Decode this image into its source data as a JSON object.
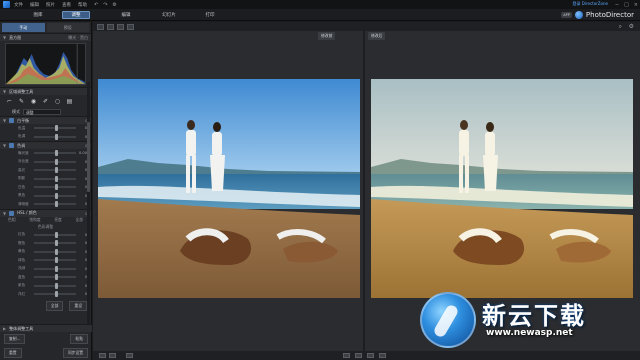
{
  "menubar": {
    "items": [
      "文件",
      "编辑",
      "照片",
      "查看",
      "帮助"
    ],
    "quick_icons": [
      "undo-icon",
      "redo-icon",
      "settings-icon"
    ],
    "signin": "登录 DirectorZone"
  },
  "window_controls": [
    "−",
    "□",
    "×"
  ],
  "modules": {
    "tabs": [
      {
        "label": "图库",
        "active": false
      },
      {
        "label": "调整",
        "active": true
      },
      {
        "label": "编辑",
        "active": false
      },
      {
        "label": "幻灯片",
        "active": false
      },
      {
        "label": "打印",
        "active": false
      }
    ]
  },
  "brand": {
    "badge": "APP",
    "title": "PhotoDirector"
  },
  "left_panel": {
    "tabs": [
      {
        "label": "手动",
        "active": true
      },
      {
        "label": "预设",
        "active": false
      }
    ],
    "histogram": {
      "title": "直方图",
      "right": "曝光 · 黑白"
    },
    "regional": {
      "title": "区域调整工具"
    },
    "mode": {
      "label": "模式",
      "value": "调整"
    },
    "white_balance": {
      "title": "白平衡",
      "sliders": [
        {
          "label": "色温",
          "value": "0",
          "pos": 0.5
        },
        {
          "label": "色调",
          "value": "0",
          "pos": 0.5
        }
      ]
    },
    "tone": {
      "title": "色调",
      "sliders": [
        {
          "label": "曝光度",
          "value": "0.00",
          "pos": 0.5
        },
        {
          "label": "对比度",
          "value": "0",
          "pos": 0.5
        },
        {
          "label": "高光",
          "value": "0",
          "pos": 0.5
        },
        {
          "label": "阴影",
          "value": "0",
          "pos": 0.5
        },
        {
          "label": "白色",
          "value": "0",
          "pos": 0.5
        },
        {
          "label": "黑色",
          "value": "0",
          "pos": 0.5
        },
        {
          "label": "清晰度",
          "value": "0",
          "pos": 0.5
        }
      ]
    },
    "hsl": {
      "title": "HSL / 颜色",
      "subtabs": [
        "色相",
        "饱和度",
        "亮度",
        "全部"
      ],
      "sub_label": "色彩调整",
      "sliders": [
        {
          "label": "红色",
          "value": "0",
          "pos": 0.5
        },
        {
          "label": "橙色",
          "value": "0",
          "pos": 0.5
        },
        {
          "label": "黄色",
          "value": "0",
          "pos": 0.5
        },
        {
          "label": "绿色",
          "value": "0",
          "pos": 0.5
        },
        {
          "label": "浅绿",
          "value": "0",
          "pos": 0.5
        },
        {
          "label": "蓝色",
          "value": "0",
          "pos": 0.5
        },
        {
          "label": "紫色",
          "value": "0",
          "pos": 0.5
        },
        {
          "label": "洋红",
          "value": "0",
          "pos": 0.5
        }
      ]
    },
    "reset_buttons": {
      "left": "全部",
      "right": "重设"
    },
    "footer": {
      "title": "整体调整工具",
      "buttons": [
        {
          "label": "复制..."
        },
        {
          "label": "粘贴"
        },
        {
          "label": "重置"
        },
        {
          "label": "同步设置"
        }
      ]
    }
  },
  "main": {
    "label_before": "修改前",
    "label_after": "修改后"
  },
  "watermark": {
    "text": "新云下载",
    "url": "www.newasp.net"
  }
}
